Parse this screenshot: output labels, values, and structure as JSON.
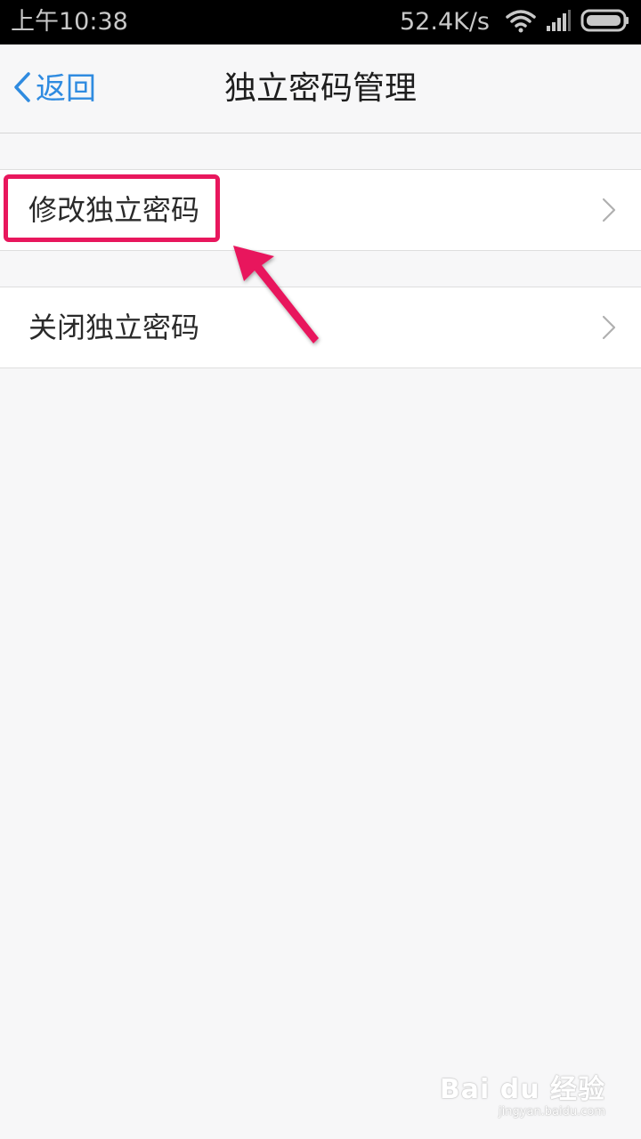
{
  "status_bar": {
    "time": "上午10:38",
    "network_speed": "52.4K/s",
    "icons": [
      "wifi-icon",
      "signal-icon",
      "battery-icon"
    ]
  },
  "nav": {
    "back_label": "返回",
    "title": "独立密码管理"
  },
  "menu": {
    "items": [
      {
        "label": "修改独立密码",
        "icon": "chevron-right-icon"
      },
      {
        "label": "关闭独立密码",
        "icon": "chevron-right-icon"
      }
    ]
  },
  "annotation": {
    "color": "#e8175d"
  },
  "watermark": {
    "main": "Bai du 经验",
    "sub": "jingyan.baidu.com"
  },
  "colors": {
    "accent": "#2f8be0",
    "background": "#f7f7f8",
    "status_bar": "#000000"
  }
}
